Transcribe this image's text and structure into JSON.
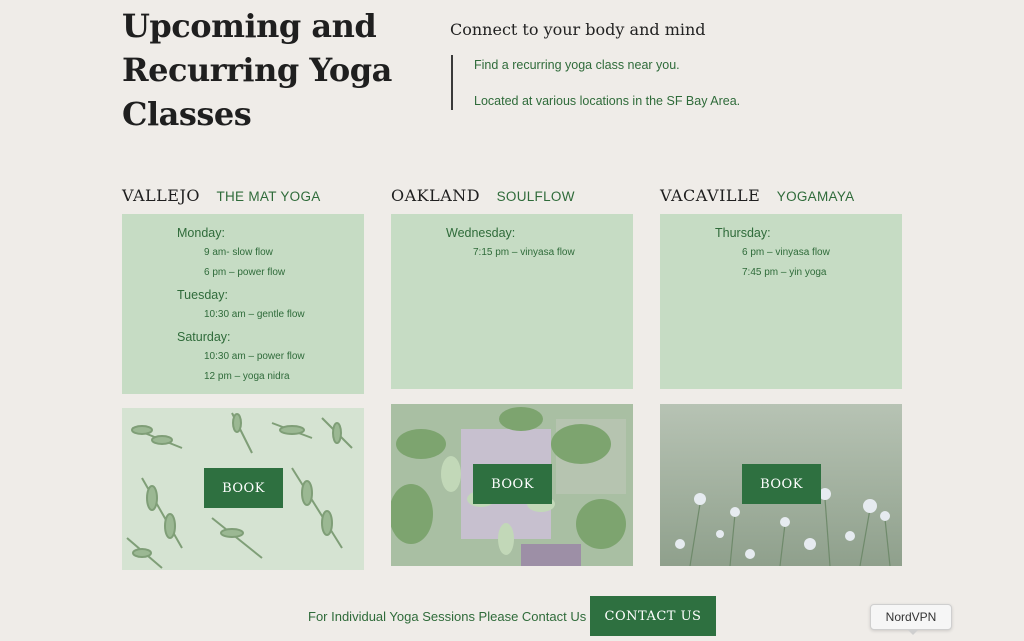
{
  "header": {
    "title": "Upcoming and Recurring Yoga Classes",
    "intro_heading": "Connect to your body and mind",
    "intro_lines": [
      "Find a recurring yoga class near you.",
      "Located at various locations in the SF Bay Area."
    ]
  },
  "locations": [
    {
      "city": "VALLEJO",
      "studio": "THE MAT YOGA",
      "schedule": [
        {
          "day": "Monday:",
          "slots": [
            "9 am- slow flow",
            "6 pm – power flow"
          ]
        },
        {
          "day": "Tuesday:",
          "slots": [
            "10:30 am – gentle flow"
          ]
        },
        {
          "day": "Saturday:",
          "slots": [
            "10:30 am – power flow",
            "12 pm – yoga nidra"
          ]
        }
      ],
      "book_label": "BOOK"
    },
    {
      "city": "OAKLAND",
      "studio": "SOULFLOW",
      "schedule": [
        {
          "day": "Wednesday:",
          "slots": [
            "7:15 pm – vinyasa flow"
          ]
        }
      ],
      "book_label": "BOOK"
    },
    {
      "city": "VACAVILLE",
      "studio": "YOGAMAYA",
      "schedule": [
        {
          "day": "Thursday:",
          "slots": [
            "6 pm – vinyasa flow",
            "7:45 pm – yin yoga"
          ]
        }
      ],
      "book_label": "BOOK"
    }
  ],
  "footer": {
    "text": "For Individual Yoga Sessions Please Contact Us",
    "contact_label": "CONTACT US"
  },
  "overlay": {
    "tooltip": "NordVPN"
  },
  "colors": {
    "background": "#efece8",
    "accent_green": "#2e7040",
    "text_green": "#2f6b3a",
    "schedule_bg": "#c6dcc4"
  }
}
